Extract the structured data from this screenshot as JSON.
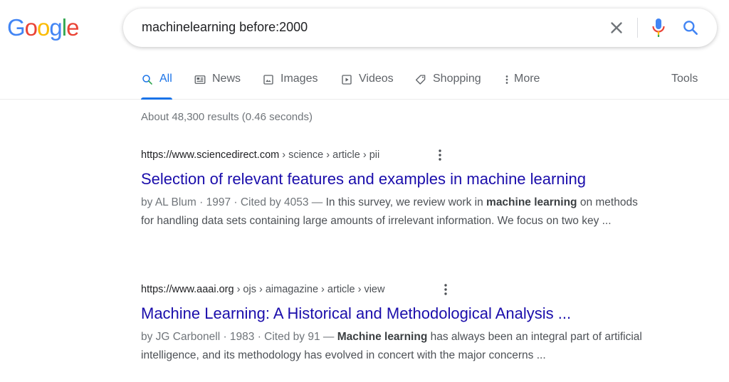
{
  "logo": {
    "letters": [
      "G",
      "o",
      "o",
      "g",
      "l",
      "e"
    ],
    "colors": [
      "#4285f4",
      "#ea4335",
      "#fbbc05",
      "#4285f4",
      "#34a853",
      "#ea4335"
    ]
  },
  "search": {
    "query": "machinelearning before:2000"
  },
  "icons": {
    "clear": "close-icon",
    "mic": "mic-icon",
    "search": "search-icon"
  },
  "tabs": [
    {
      "label": "All",
      "icon": "search-icon",
      "active": true
    },
    {
      "label": "News",
      "icon": "news-icon"
    },
    {
      "label": "Images",
      "icon": "image-icon"
    },
    {
      "label": "Videos",
      "icon": "video-icon"
    },
    {
      "label": "Shopping",
      "icon": "tag-icon"
    },
    {
      "label": "More",
      "icon": "more-vert-icon"
    }
  ],
  "tools_label": "Tools",
  "stats": "About 48,300 results (0.46 seconds)",
  "results": [
    {
      "site": "https://www.sciencedirect.com",
      "path": "› science › article › pii",
      "title": "Selection of relevant features and examples in machine learning",
      "meta": "by AL Blum · 1997 · Cited by 4053 — ",
      "snippet_a": "In this survey, we review work in ",
      "snippet_bold": "machine learning",
      "snippet_b": " on methods for handling data sets containing large amounts of irrelevant information. We focus on two key ..."
    },
    {
      "site": "https://www.aaai.org",
      "path": "› ojs › aimagazine › article › view",
      "title": "Machine Learning: A Historical and Methodological Analysis ...",
      "meta": "by JG Carbonell · 1983 · Cited by 91 — ",
      "snippet_a": "",
      "snippet_bold": "Machine learning",
      "snippet_b": " has always been an integral part of artificial intelligence, and its methodology has evolved in concert with the major concerns ..."
    }
  ],
  "colors": {
    "link": "#1a0dab",
    "accent": "#1a73e8",
    "muted": "#70757a"
  }
}
